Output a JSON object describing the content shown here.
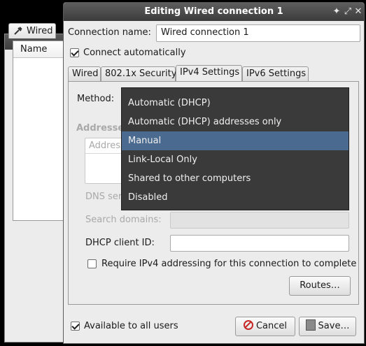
{
  "background_window": {
    "tab_label": "Wired",
    "list_header": "Name"
  },
  "dialog": {
    "title": "Editing Wired connection 1",
    "connection_name_label": "Connection name:",
    "connection_name_value": "Wired connection 1",
    "connect_automatically_label": "Connect automatically",
    "connect_automatically_checked": true,
    "tabs": [
      {
        "label": "Wired"
      },
      {
        "label": "802.1x Security"
      },
      {
        "label": "IPv4 Settings"
      },
      {
        "label": "IPv6 Settings"
      }
    ],
    "active_tab": "IPv4 Settings",
    "method_label": "Method:",
    "addresses_label": "Addresses",
    "address_column": "Address",
    "dns_label": "DNS servers:",
    "search_domains_label": "Search domains:",
    "dhcp_client_id_label": "DHCP client ID:",
    "require_ipv4_label": "Require IPv4 addressing for this connection to complete",
    "routes_button": "Routes…",
    "available_all_users_label": "Available to all users",
    "cancel_button": "Cancel",
    "save_button": "Save…"
  },
  "method_dropdown": {
    "options": [
      "Automatic (DHCP)",
      "Automatic (DHCP) addresses only",
      "Manual",
      "Link-Local Only",
      "Shared to other computers",
      "Disabled"
    ],
    "highlighted": "Manual"
  },
  "colors": {
    "titlebar": "#3b3b3b",
    "popup_background": "#3a3a3a",
    "popup_highlight": "#4a6a8f"
  }
}
